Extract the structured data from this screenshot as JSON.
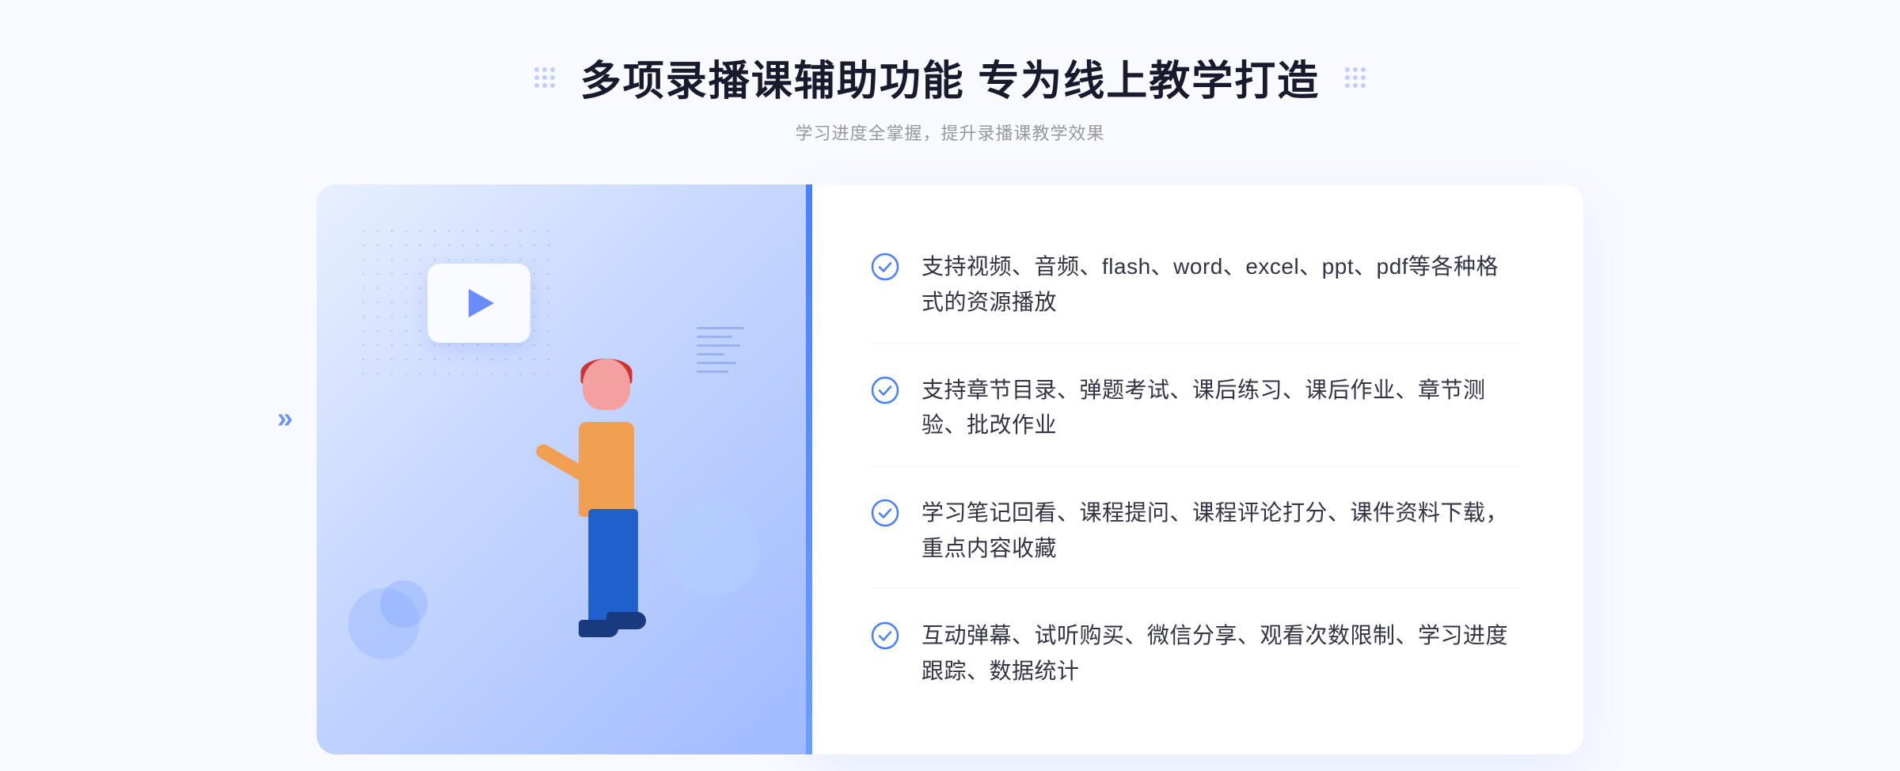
{
  "header": {
    "title": "多项录播课辅助功能 专为线上教学打造",
    "subtitle": "学习进度全掌握，提升录播课教学效果"
  },
  "features": [
    {
      "id": "feature-1",
      "text": "支持视频、音频、flash、word、excel、ppt、pdf等各种格式的资源播放"
    },
    {
      "id": "feature-2",
      "text": "支持章节目录、弹题考试、课后练习、课后作业、章节测验、批改作业"
    },
    {
      "id": "feature-3",
      "text": "学习笔记回看、课程提问、课程评论打分、课件资料下载，重点内容收藏"
    },
    {
      "id": "feature-4",
      "text": "互动弹幕、试听购买、微信分享、观看次数限制、学习进度跟踪、数据统计"
    }
  ],
  "decoration": {
    "left_chevrons": "»",
    "accent_color": "#4a7fff"
  }
}
